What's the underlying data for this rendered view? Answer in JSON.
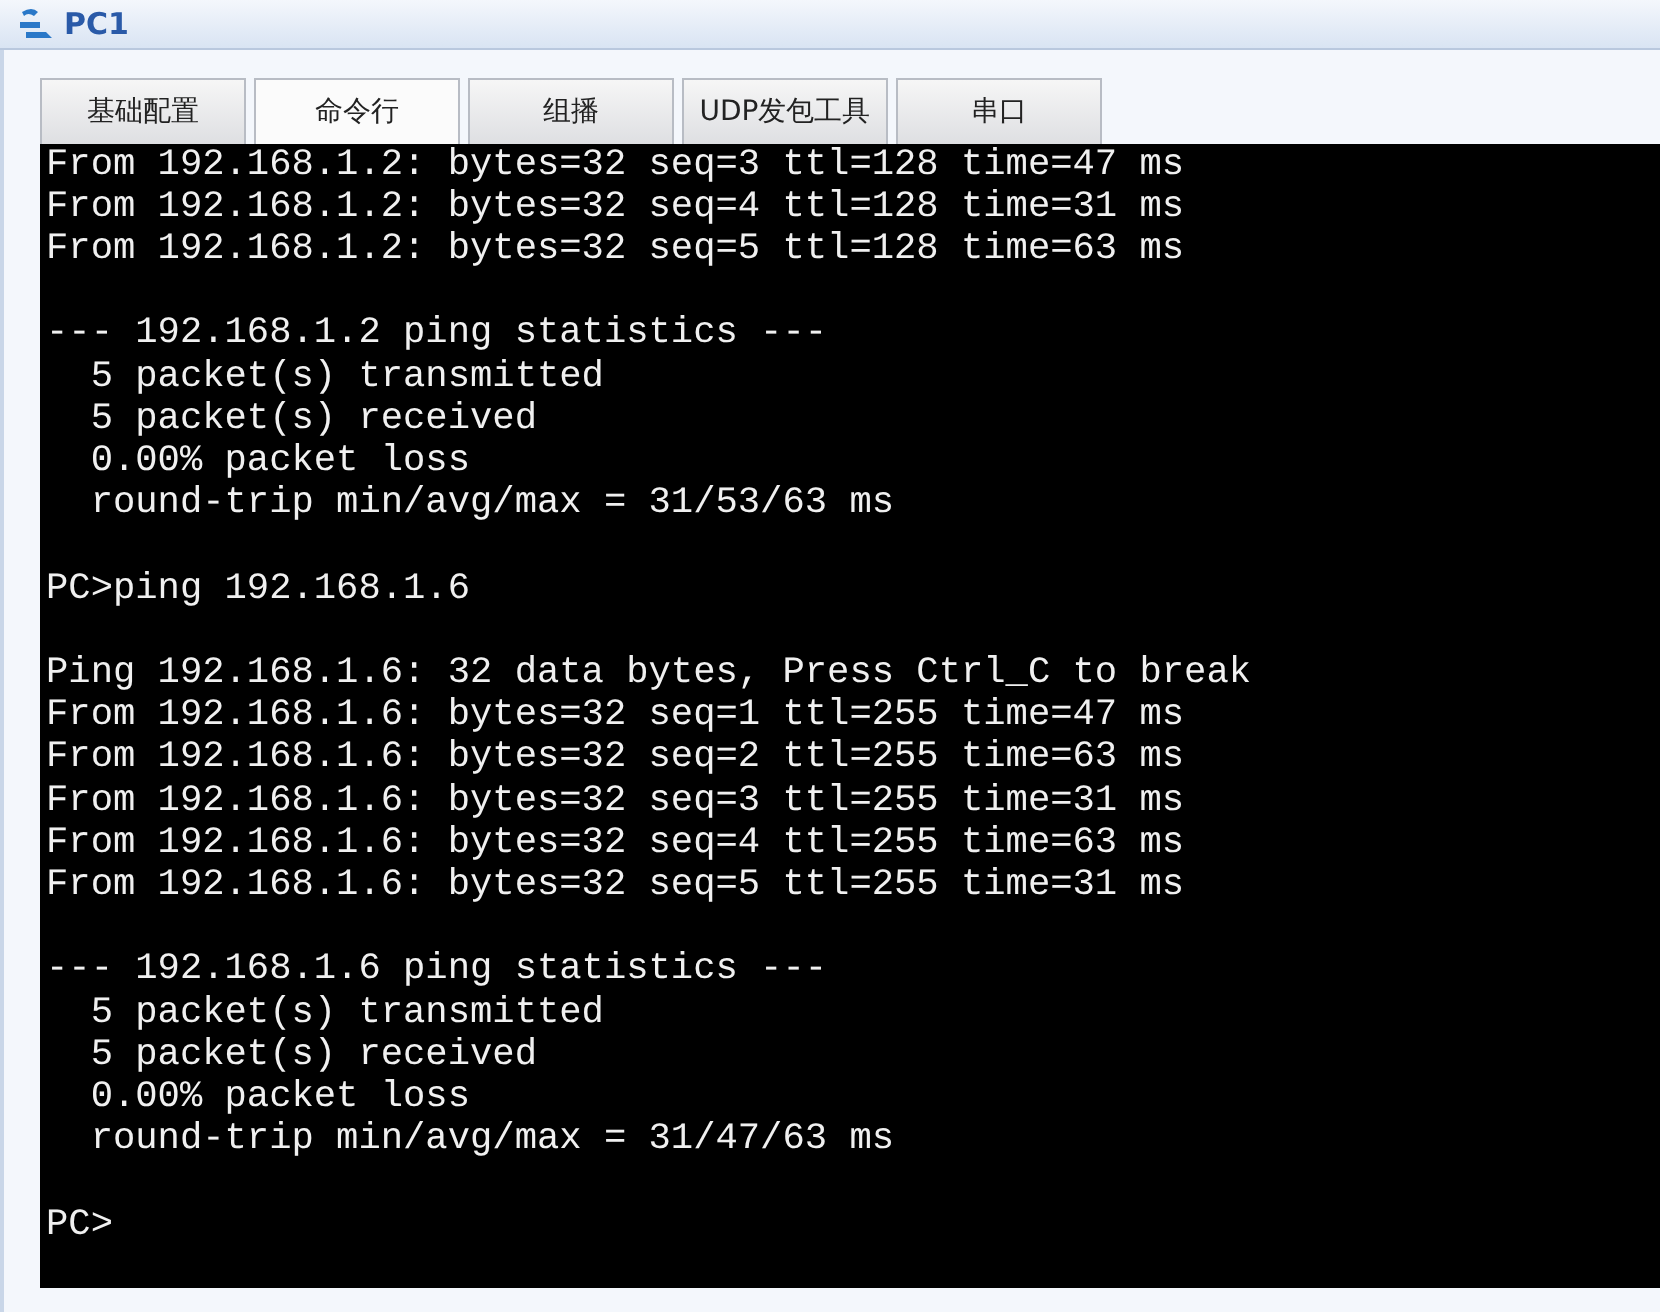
{
  "window": {
    "title": "PC1"
  },
  "tabs": [
    {
      "label": "基础配置",
      "selected": false
    },
    {
      "label": "命令行",
      "selected": true
    },
    {
      "label": "组播",
      "selected": false
    },
    {
      "label": "UDP发包工具",
      "selected": false
    },
    {
      "label": "串口",
      "selected": false
    }
  ],
  "terminal": {
    "blocks": [
      [
        "From 192.168.1.2: bytes=32 seq=3 ttl=128 time=47 ms",
        "From 192.168.1.2: bytes=32 seq=4 ttl=128 time=31 ms",
        "From 192.168.1.2: bytes=32 seq=5 ttl=128 time=63 ms"
      ],
      [
        "--- 192.168.1.2 ping statistics ---",
        "  5 packet(s) transmitted",
        "  5 packet(s) received",
        "  0.00% packet loss",
        "  round-trip min/avg/max = 31/53/63 ms"
      ],
      [
        "PC>ping 192.168.1.6"
      ],
      [
        "Ping 192.168.1.6: 32 data bytes, Press Ctrl_C to break",
        "From 192.168.1.6: bytes=32 seq=1 ttl=255 time=47 ms",
        "From 192.168.1.6: bytes=32 seq=2 ttl=255 time=63 ms",
        "From 192.168.1.6: bytes=32 seq=3 ttl=255 time=31 ms",
        "From 192.168.1.6: bytes=32 seq=4 ttl=255 time=63 ms",
        "From 192.168.1.6: bytes=32 seq=5 ttl=255 time=31 ms"
      ],
      [
        "--- 192.168.1.6 ping statistics ---",
        "  5 packet(s) transmitted",
        "  5 packet(s) received",
        "  0.00% packet loss",
        "  round-trip min/avg/max = 31/47/63 ms"
      ],
      [
        "PC>"
      ]
    ]
  }
}
